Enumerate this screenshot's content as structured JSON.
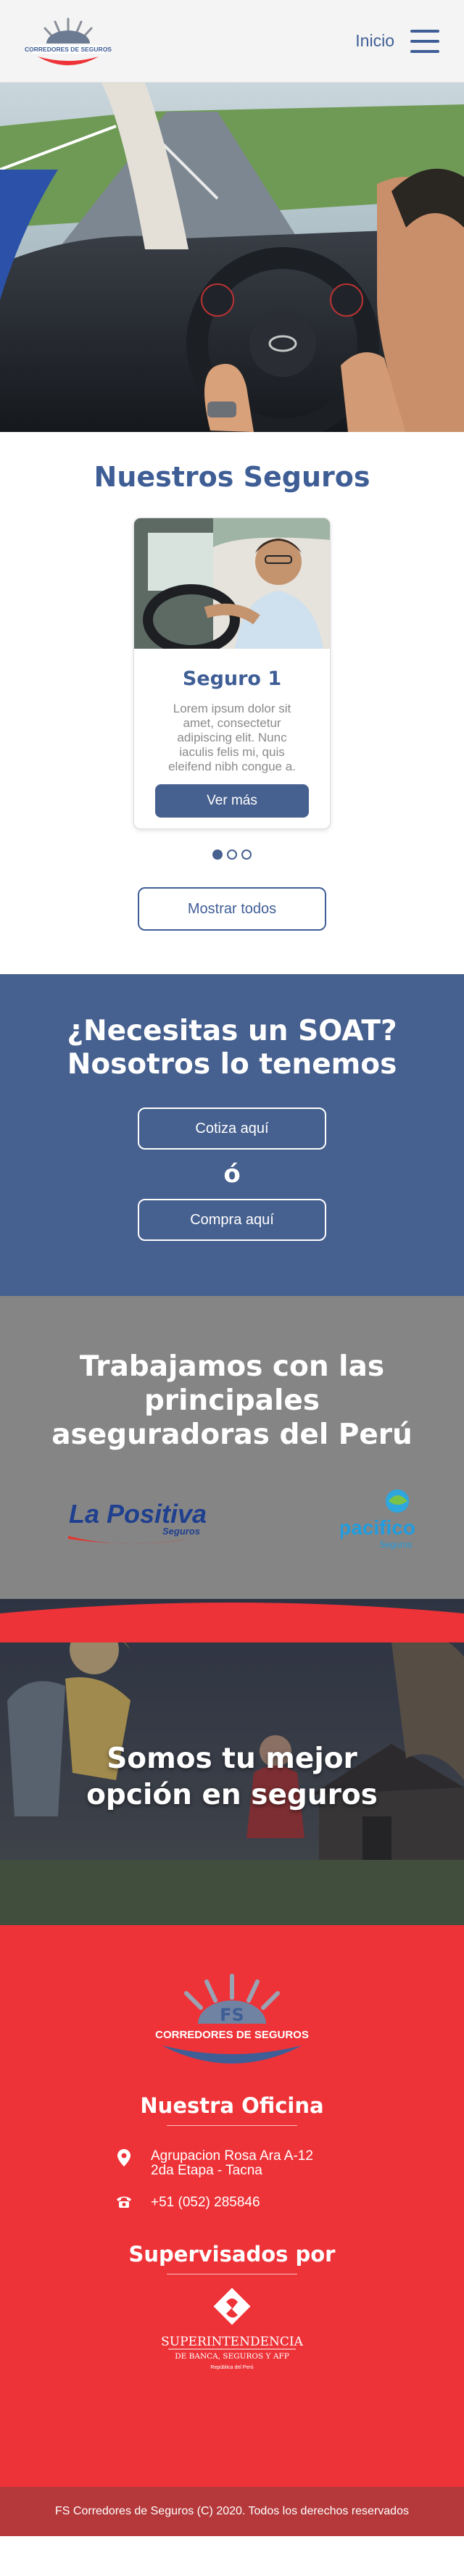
{
  "header": {
    "logo_text": "CORREDORES DE SEGUROS",
    "nav_home": "Inicio"
  },
  "seguros": {
    "title": "Nuestros Seguros",
    "card": {
      "title": "Seguro 1",
      "text": "Lorem ipsum dolor sit amet, consectetur adipiscing elit. Nunc iaculis felis mi, quis eleifend nibh congue a.",
      "button": "Ver más"
    },
    "show_all": "Mostrar todos"
  },
  "soat": {
    "title_line1": "¿Necesitas un SOAT?",
    "title_line2": "Nosotros lo tenemos",
    "quote_button": "Cotiza aquí",
    "or": "ó",
    "buy_button": "Compra aquí"
  },
  "aseguradoras": {
    "title_line1": "Trabajamos con las",
    "title_line2": "principales",
    "title_line3": "aseguradoras del Perú",
    "positiva_name": "La Positiva",
    "positiva_sub": "Seguros",
    "pacifico_name": "pacifico",
    "pacifico_sub": "Seguros"
  },
  "banner": {
    "line1": "Somos tu mejor",
    "line2": "opción en seguros"
  },
  "footer": {
    "logo_initials": "FS",
    "logo_text": "CORREDORES DE SEGUROS",
    "office_title": "Nuestra Oficina",
    "address_line1": "Agrupacion Rosa Ara A-12",
    "address_line2": "2da Etapa - Tacna",
    "phone": "+51 (052) 285846",
    "supervised_title": "Supervisados por",
    "sbs_line1": "SUPERINTENDENCIA",
    "sbs_line2": "DE BANCA, SEGUROS Y AFP",
    "sbs_line3": "República del Perú",
    "copyright": "FS Corredores de Seguros (C) 2020. Todos los derechos reservados"
  },
  "colors": {
    "primary_blue": "#3f5e96",
    "brand_red": "#ee3338",
    "gray_band": "#858585",
    "copyright_bar": "#b5393b"
  },
  "icons": [
    "menu-icon",
    "location-pin-icon",
    "phone-icon"
  ]
}
